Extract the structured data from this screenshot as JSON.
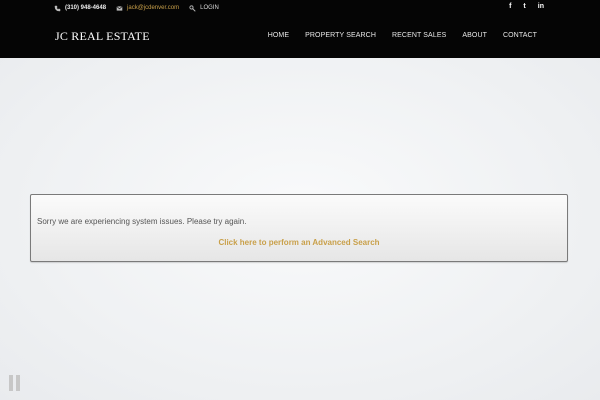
{
  "header": {
    "phone": "(310) 948-4648",
    "email": "jack@jcdenver.com",
    "login": "LOGIN",
    "social": [
      {
        "name": "facebook-icon",
        "glyph": "f"
      },
      {
        "name": "twitter-icon",
        "glyph": "t"
      },
      {
        "name": "linkedin-icon",
        "glyph": "in"
      }
    ],
    "brand": "JC REAL ESTATE",
    "nav": [
      "HOME",
      "PROPERTY SEARCH",
      "RECENT SALES",
      "ABOUT",
      "CONTACT"
    ]
  },
  "notice": {
    "message": "Sorry we are experiencing system issues. Please try again.",
    "link": "Click here to perform an Advanced Search"
  },
  "slider": {
    "pause_icon": "pause-icon"
  },
  "colors": {
    "accent": "#c9a04a",
    "topbar": "#050505"
  }
}
